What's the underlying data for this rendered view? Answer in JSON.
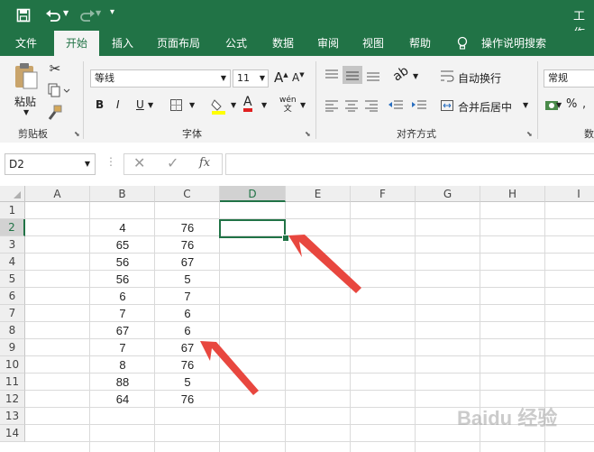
{
  "title_text": "工作",
  "quick_access": {
    "save_icon": "save-icon",
    "undo_icon": "undo-icon",
    "redo_icon": "redo-icon"
  },
  "tabs": [
    "文件",
    "开始",
    "插入",
    "页面布局",
    "公式",
    "数据",
    "审阅",
    "视图",
    "帮助",
    "操作说明搜索"
  ],
  "ribbon": {
    "paste_label": "粘贴",
    "clipboard_label": "剪贴板",
    "font_name": "等线",
    "font_size": "11",
    "font_group_label": "字体",
    "bold": "B",
    "italic": "I",
    "underline": "U",
    "wrap_text": "自动换行",
    "merge_center": "合并后居中",
    "align_group_label": "对齐方式",
    "number_format": "常规",
    "number_group_label": "数",
    "font_grow": "A",
    "font_shrink": "A",
    "font_color": "A",
    "wen": "wén",
    "percent": "%"
  },
  "formula_bar": {
    "name_box": "D2",
    "fx": "fx",
    "formula": ""
  },
  "columns": [
    "A",
    "B",
    "C",
    "D",
    "E",
    "F",
    "G",
    "H",
    "I"
  ],
  "rows": [
    "1",
    "2",
    "3",
    "4",
    "5",
    "6",
    "7",
    "8",
    "9",
    "10",
    "11",
    "12",
    "13",
    "14"
  ],
  "column_b": [
    "4",
    "65",
    "56",
    "56",
    "6",
    "7",
    "67",
    "7",
    "8",
    "88",
    "64"
  ],
  "column_c": [
    "76",
    "76",
    "67",
    "5",
    "7",
    "6",
    "6",
    "67",
    "76",
    "5",
    "76"
  ],
  "selected_cell": "D2",
  "watermark": "Baidu 经验",
  "colors": {
    "excel_green": "#217346",
    "arrow_red": "#e8473f"
  }
}
